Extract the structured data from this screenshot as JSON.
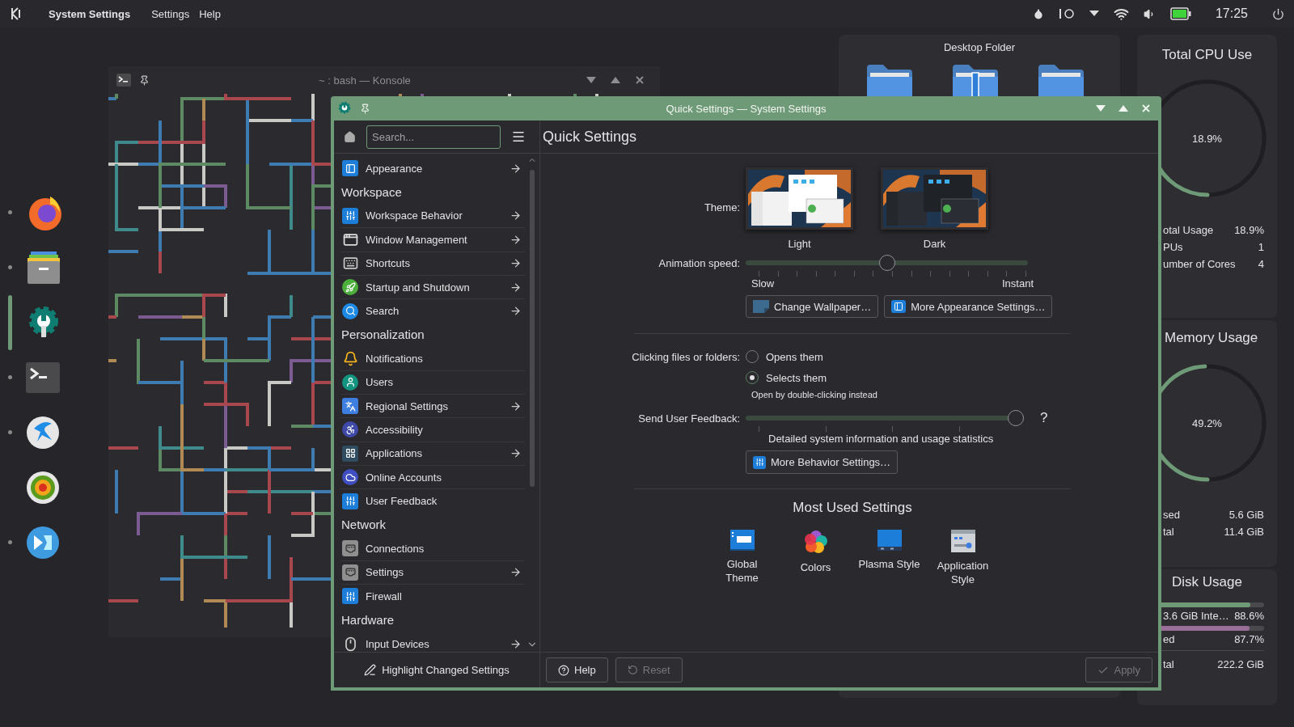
{
  "top_panel": {
    "app_title": "System Settings",
    "menus": [
      "Settings",
      "Help"
    ],
    "clock": "17:25"
  },
  "dock": [
    {
      "running": true,
      "active": false
    },
    {
      "running": true,
      "active": false
    },
    {
      "running": false,
      "active": true
    },
    {
      "running": true,
      "active": false
    },
    {
      "running": true,
      "active": false
    },
    {
      "running": false,
      "active": false
    },
    {
      "running": true,
      "active": false
    }
  ],
  "konsole": {
    "title": "~ : bash — Konsole"
  },
  "desktop_folder": {
    "title": "Desktop Folder"
  },
  "cpu_widget": {
    "title": "Total CPU Use",
    "gauge": {
      "reading": "18.9%"
    },
    "rows": [
      {
        "label": "otal Usage",
        "value": "18.9%"
      },
      {
        "label": "PUs",
        "value": "1"
      },
      {
        "label": "umber of Cores",
        "value": "4"
      }
    ]
  },
  "memory_widget": {
    "title": "Memory Usage",
    "gauge": {
      "reading": "49.2%"
    },
    "rows": [
      {
        "label": "sed",
        "value": "5.6 GiB"
      },
      {
        "label": "tal",
        "value": "11.4 GiB"
      }
    ]
  },
  "disk_widget": {
    "title": "Disk Usage",
    "bars": [
      {
        "label": "3.6 GiB Inte…",
        "value": "88.6%",
        "level": 0.886,
        "color": "#6f9a77"
      },
      {
        "label": "ed",
        "value": "87.7%",
        "level": 0.877,
        "color": "#9a6f97"
      }
    ],
    "total": {
      "label": "tal",
      "value": "222.2 GiB"
    }
  },
  "settings_window": {
    "title": "Quick Settings — System Settings",
    "search": {
      "placeholder": "Search..."
    },
    "sidebar": [
      {
        "kind": "item",
        "label": "Appearance",
        "arrow": true
      },
      {
        "kind": "category",
        "label": "Workspace"
      },
      {
        "kind": "item",
        "label": "Workspace Behavior",
        "arrow": true
      },
      {
        "kind": "item",
        "label": "Window Management",
        "arrow": true
      },
      {
        "kind": "item",
        "label": "Shortcuts",
        "arrow": true
      },
      {
        "kind": "item",
        "label": "Startup and Shutdown",
        "arrow": true
      },
      {
        "kind": "item",
        "label": "Search",
        "arrow": true
      },
      {
        "kind": "category",
        "label": "Personalization"
      },
      {
        "kind": "item",
        "label": "Notifications",
        "arrow": false
      },
      {
        "kind": "item",
        "label": "Users",
        "arrow": false
      },
      {
        "kind": "item",
        "label": "Regional Settings",
        "arrow": true
      },
      {
        "kind": "item",
        "label": "Accessibility",
        "arrow": false
      },
      {
        "kind": "item",
        "label": "Applications",
        "arrow": true
      },
      {
        "kind": "item",
        "label": "Online Accounts",
        "arrow": false
      },
      {
        "kind": "item",
        "label": "User Feedback",
        "arrow": false
      },
      {
        "kind": "category",
        "label": "Network"
      },
      {
        "kind": "item",
        "label": "Connections",
        "arrow": false
      },
      {
        "kind": "item",
        "label": "Settings",
        "arrow": true
      },
      {
        "kind": "item",
        "label": "Firewall",
        "arrow": false
      },
      {
        "kind": "category",
        "label": "Hardware"
      },
      {
        "kind": "item",
        "label": "Input Devices",
        "arrow": true
      }
    ],
    "highlight_button": "Highlight Changed Settings",
    "page_title": "Quick Settings",
    "theme": {
      "label": "Theme:",
      "options": [
        {
          "name": "Light",
          "kind": "light"
        },
        {
          "name": "Dark",
          "kind": "dark"
        }
      ]
    },
    "animation": {
      "label": "Animation speed:",
      "level": 0.5,
      "min_label": "Slow",
      "max_label": "Instant"
    },
    "appearance_buttons": [
      "Change Wallpaper…",
      "More Appearance Settings…"
    ],
    "clicking": {
      "label": "Clicking files or folders:",
      "options": [
        {
          "label": "Opens them",
          "selected": false
        },
        {
          "label": "Selects them",
          "selected": true
        }
      ],
      "hint": "Open by double-clicking instead"
    },
    "feedback": {
      "label": "Send User Feedback:",
      "level": 1,
      "help": "?",
      "caption": "Detailed system information and usage statistics",
      "button": "More Behavior Settings…"
    },
    "most_used": {
      "title": "Most Used Settings",
      "items": [
        {
          "lines": [
            "Global",
            "Theme"
          ]
        },
        {
          "lines": [
            "Colors"
          ]
        },
        {
          "lines": [
            "Plasma Style"
          ]
        },
        {
          "lines": [
            "Application",
            "Style"
          ]
        }
      ]
    },
    "footer": {
      "help": "Help",
      "reset": {
        "label": "Reset",
        "disabled": true
      },
      "apply": {
        "label": "Apply",
        "disabled": true
      }
    }
  }
}
